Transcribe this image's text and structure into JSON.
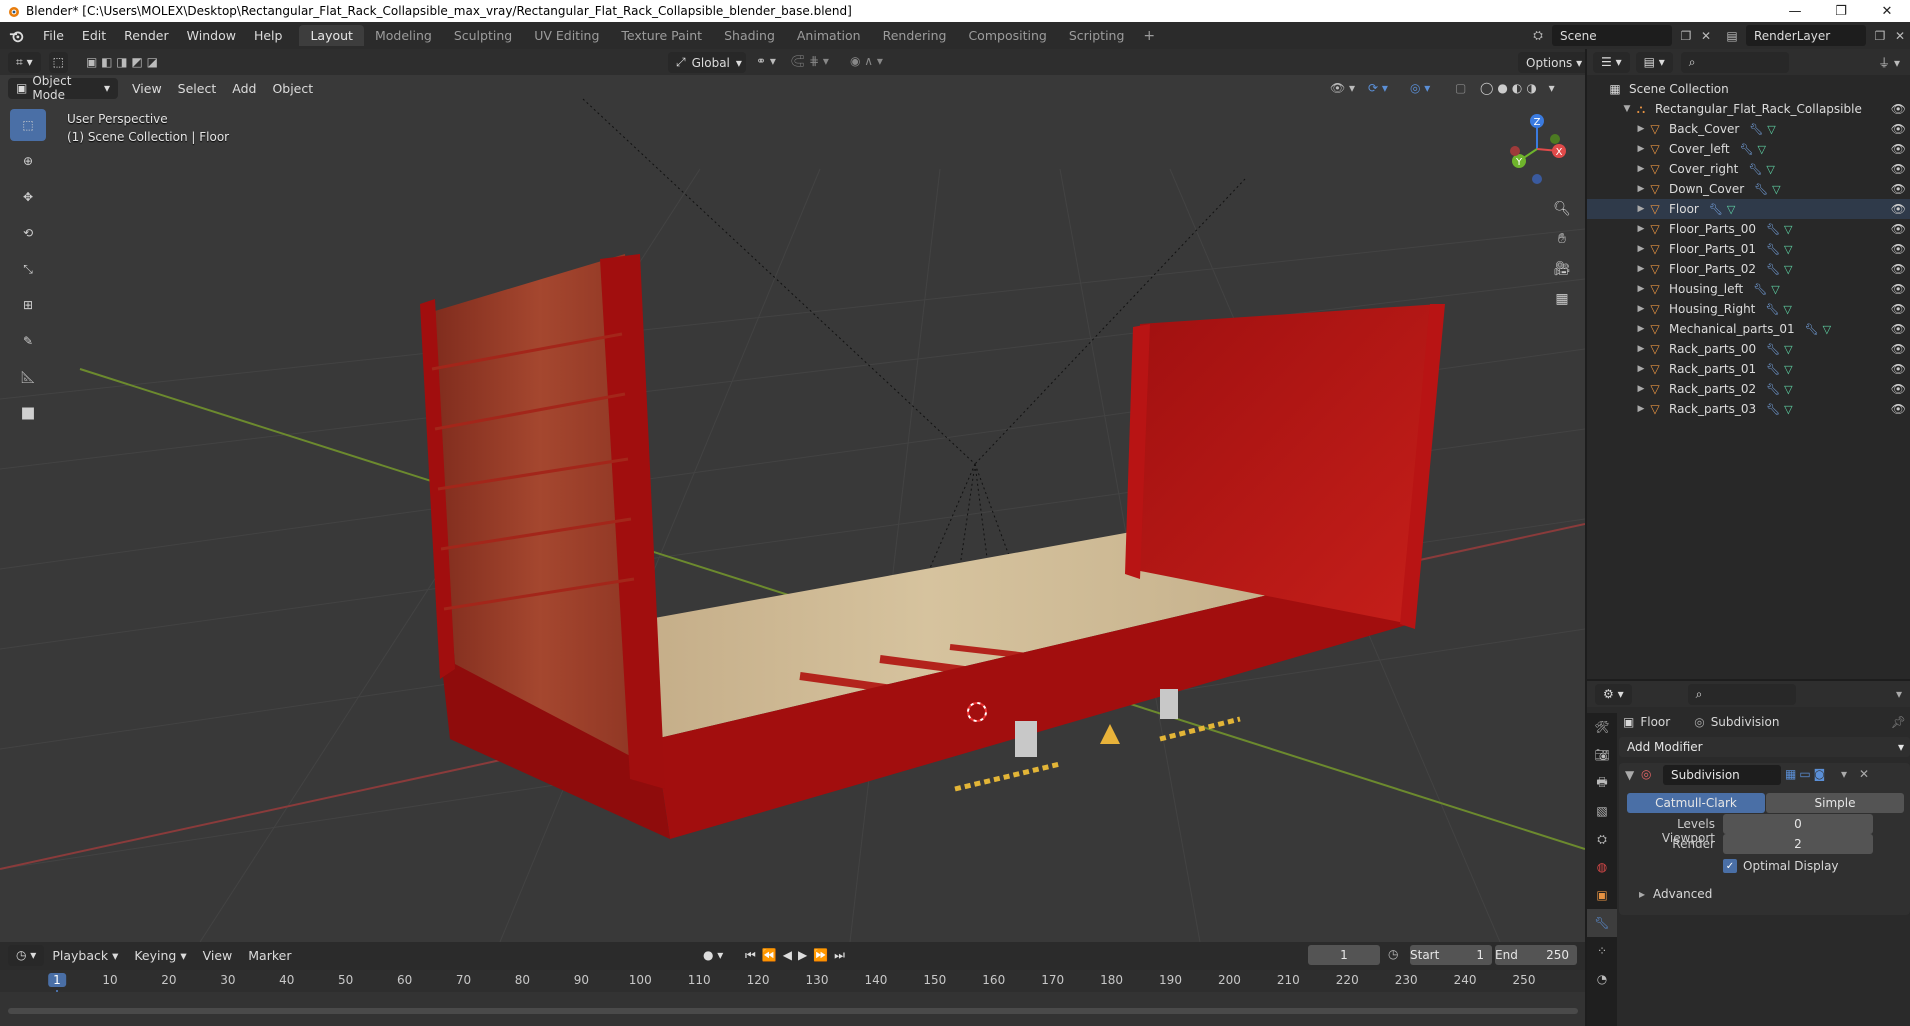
{
  "window": {
    "title": "Blender* [C:\\Users\\MOLEX\\Desktop\\Rectangular_Flat_Rack_Collapsible_max_vray/Rectangular_Flat_Rack_Collapsible_blender_base.blend]",
    "minimize": "—",
    "maximize": "❐",
    "close": "✕"
  },
  "menubar": {
    "items": [
      "File",
      "Edit",
      "Render",
      "Window",
      "Help"
    ],
    "workspaces": [
      "Layout",
      "Modeling",
      "Sculpting",
      "UV Editing",
      "Texture Paint",
      "Shading",
      "Animation",
      "Rendering",
      "Compositing",
      "Scripting"
    ],
    "active_workspace": "Layout",
    "add": "+",
    "scene": "Scene",
    "view_layer": "RenderLayer"
  },
  "viewport": {
    "transform_orientation": "Global",
    "options": "Options",
    "mode": "Object Mode",
    "menus": [
      "View",
      "Select",
      "Add",
      "Object"
    ],
    "info_line1": "User Perspective",
    "info_line2": "(1) Scene Collection | Floor",
    "gizmo": {
      "x": "X",
      "y": "Y",
      "z": "Z"
    }
  },
  "outliner": {
    "root": "Scene Collection",
    "collection": "Rectangular_Flat_Rack_Collapsible",
    "objects": [
      "Back_Cover",
      "Cover_left",
      "Cover_right",
      "Down_Cover",
      "Floor",
      "Floor_Parts_00",
      "Floor_Parts_01",
      "Floor_Parts_02",
      "Housing_left",
      "Housing_Right",
      "Mechanical_parts_01",
      "Rack_parts_00",
      "Rack_parts_01",
      "Rack_parts_02",
      "Rack_parts_03"
    ],
    "selected": "Floor"
  },
  "properties": {
    "object": "Floor",
    "modifier_tab": "Subdivision",
    "add_modifier": "Add Modifier",
    "modifier_name": "Subdivision",
    "type_a": "Catmull-Clark",
    "type_b": "Simple",
    "levels_viewport_label": "Levels Viewport",
    "levels_viewport": "0",
    "render_label": "Render",
    "render": "2",
    "optimal_display": "Optimal Display",
    "advanced": "Advanced"
  },
  "timeline": {
    "menus": [
      "Playback",
      "Keying",
      "View",
      "Marker"
    ],
    "current_frame": "1",
    "start_label": "Start",
    "start": "1",
    "end_label": "End",
    "end": "250",
    "ticks": [
      "1",
      "10",
      "20",
      "30",
      "40",
      "50",
      "60",
      "70",
      "80",
      "90",
      "100",
      "110",
      "120",
      "130",
      "140",
      "150",
      "160",
      "170",
      "180",
      "190",
      "200",
      "210",
      "220",
      "230",
      "240",
      "250"
    ]
  },
  "colors": {
    "rack_red": "#b0100f",
    "wood": "#c9b48e",
    "accent_blue": "#4a6fa6",
    "viewport_bg": "#393939"
  }
}
